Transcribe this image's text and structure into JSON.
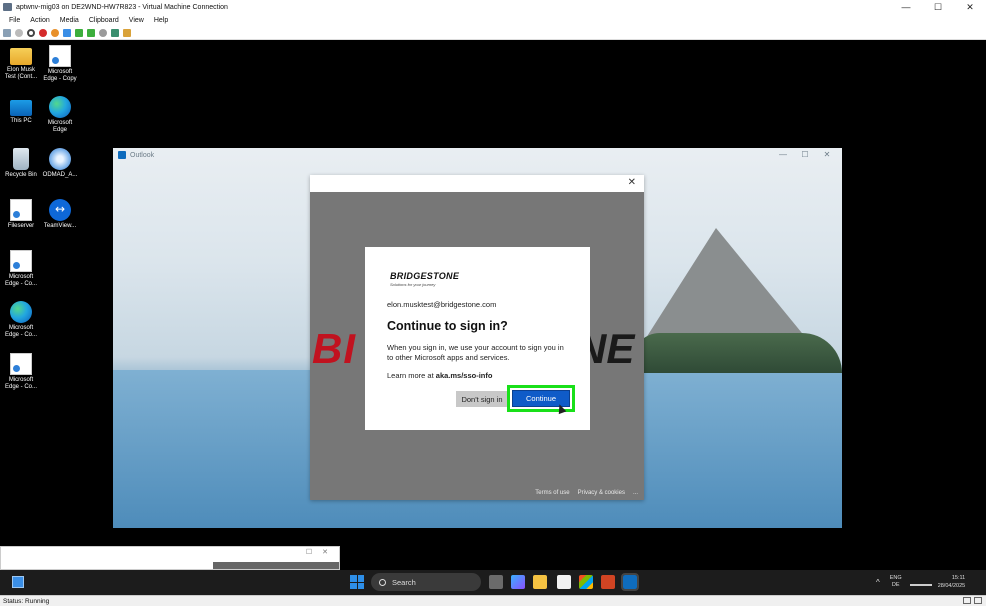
{
  "vm": {
    "title": "aptwnv-mig03 on DE2WND-HW7R823 - Virtual Machine Connection",
    "menu": [
      "File",
      "Action",
      "Media",
      "Clipboard",
      "View",
      "Help"
    ],
    "status": "Status: Running"
  },
  "desktop": {
    "icons": [
      {
        "label": "Elon Musk Test (Cont...",
        "icon": "folder-icon"
      },
      {
        "label": "Microsoft Edge - Copy",
        "icon": "file-shortcut-icon"
      },
      {
        "label": "This PC",
        "icon": "monitor-icon"
      },
      {
        "label": "Microsoft Edge",
        "icon": "edge-icon"
      },
      {
        "label": "Recycle Bin",
        "icon": "recycle-bin-icon"
      },
      {
        "label": "ODMAD_A...",
        "icon": "disc-icon"
      },
      {
        "label": "Fileserver",
        "icon": "file-shortcut-icon"
      },
      {
        "label": "TeamView...",
        "icon": "teamviewer-icon"
      },
      {
        "label": "Microsoft Edge - Co...",
        "icon": "file-shortcut-icon"
      },
      {
        "label": "Microsoft Edge - Co...",
        "icon": "edge-icon"
      },
      {
        "label": "Microsoft Edge - Co...",
        "icon": "file-shortcut-icon"
      }
    ]
  },
  "outlook": {
    "title": "Outlook"
  },
  "signin": {
    "brand_watermark_left": "BI",
    "brand_watermark_right": "NE",
    "logo_wordmark": "BRIDGESTONE",
    "logo_tagline": "Solutions for your journey",
    "email": "elon.musktest@bridgestone.com",
    "heading": "Continue to sign in?",
    "description": "When you sign in, we use your account to sign you in to other Microsoft apps and services.",
    "learn_prefix": "Learn more at ",
    "learn_link": "aka.ms/sso-info",
    "dont_sign_in": "Don't sign in",
    "continue": "Continue",
    "footer_terms": "Terms of use",
    "footer_privacy": "Privacy & cookies",
    "footer_more": "..."
  },
  "taskbar": {
    "search_placeholder": "Search",
    "lang_line1": "ENG",
    "lang_line2": "DE",
    "time": "15:11",
    "date": "28/04/2025"
  },
  "colors": {
    "accent_continue": "#0f5bc8",
    "highlight": "#19e019",
    "brand_red": "#c1121f"
  }
}
